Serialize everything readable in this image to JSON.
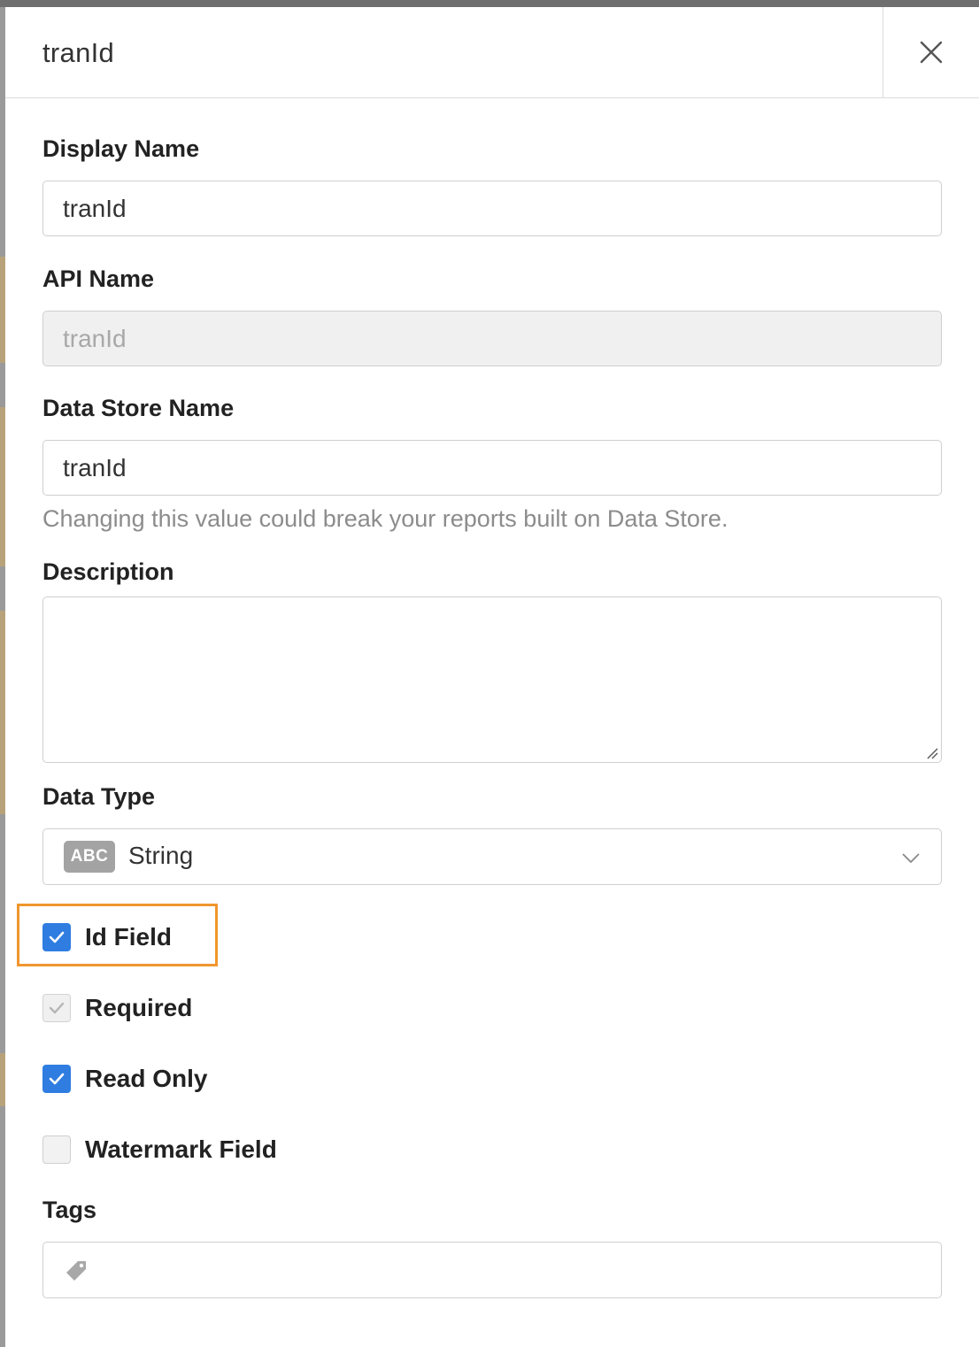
{
  "panel": {
    "title": "tranId"
  },
  "form": {
    "display_name": {
      "label": "Display Name",
      "value": "tranId"
    },
    "api_name": {
      "label": "API Name",
      "value": "tranId"
    },
    "data_store_name": {
      "label": "Data Store Name",
      "value": "tranId",
      "hint": "Changing this value could break your reports built on Data Store."
    },
    "description": {
      "label": "Description",
      "value": ""
    },
    "data_type": {
      "label": "Data Type",
      "badge": "ABC",
      "value": "String"
    },
    "checkboxes": {
      "id_field": {
        "label": "Id Field",
        "checked": true
      },
      "required": {
        "label": "Required",
        "checked": true,
        "disabled": true
      },
      "read_only": {
        "label": "Read Only",
        "checked": true
      },
      "watermark_field": {
        "label": "Watermark Field",
        "checked": false
      }
    },
    "tags": {
      "label": "Tags",
      "value": ""
    }
  },
  "colors": {
    "checkbox_checked": "#2f7de1",
    "highlight": "#f0962e",
    "badge": "#a3a3a3"
  },
  "icons": {
    "close": "close-icon",
    "chevron": "chevron-down-icon",
    "check": "checkmark-icon",
    "tag": "tag-icon"
  }
}
